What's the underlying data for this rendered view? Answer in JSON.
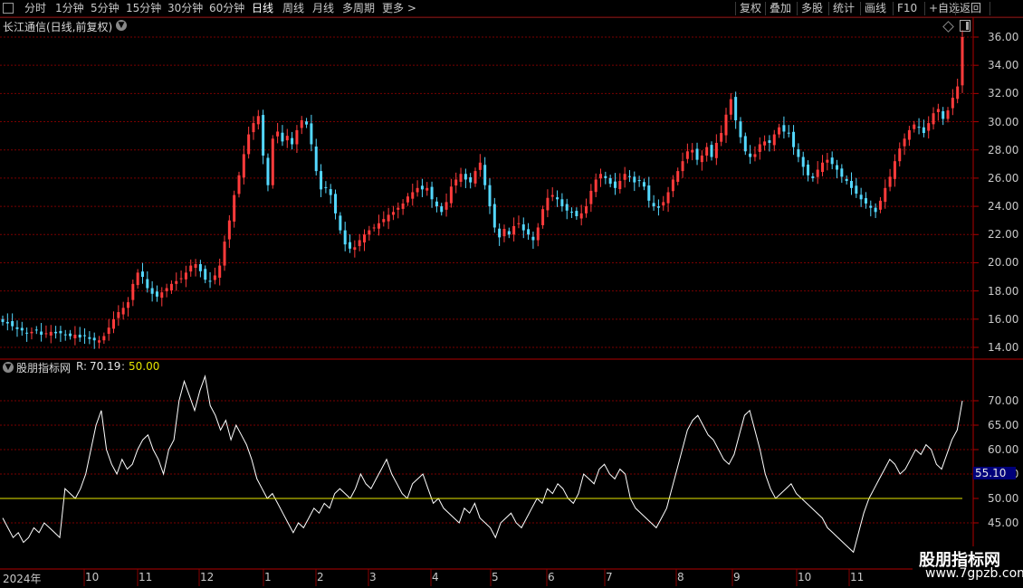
{
  "toolbar": {
    "periods": [
      "分时",
      "1分钟",
      "5分钟",
      "15分钟",
      "30分钟",
      "60分钟",
      "日线",
      "周线",
      "月线",
      "多周期",
      "更多 >"
    ],
    "active_period": "日线",
    "right_buttons": [
      "复权",
      "叠加",
      "多股",
      "统计",
      "画线",
      "F10",
      "+自选",
      "返回"
    ]
  },
  "main_chart": {
    "title": "长江通信(日线,前复权)",
    "y_ticks": [
      "36.00",
      "34.00",
      "32.00",
      "30.00",
      "28.00",
      "26.00",
      "24.00",
      "22.00",
      "20.00",
      "18.00",
      "16.00",
      "14.00"
    ],
    "up_color": "#ff3b3b",
    "down_color": "#54d8ff"
  },
  "indicator": {
    "name": "股朋指标网",
    "r_label": "R:",
    "r_value": "70.19",
    "separator": ":",
    "level_value": "50.00",
    "y_ticks": [
      "70.00",
      "65.00",
      "60.00",
      "55.00",
      "50.00",
      "45.00"
    ],
    "current_value": "55.10",
    "line_color": "#ffffff",
    "level_color": "#e6e600"
  },
  "x_axis": {
    "labels": [
      "2024年",
      "10",
      "11",
      "12",
      "1",
      "2",
      "3",
      "4",
      "5",
      "6",
      "7",
      "8",
      "9",
      "10",
      "11"
    ]
  },
  "watermark": {
    "title": "股朋指标网",
    "url": "www.7gpzb.com"
  },
  "chart_data": [
    {
      "type": "candlestick",
      "title": "长江通信(日线,前复权)",
      "ylim": [
        13.2,
        37.0
      ],
      "x_labels": [
        "2024年",
        "10",
        "11",
        "12",
        "1",
        "2",
        "3",
        "4",
        "5",
        "6",
        "7",
        "8",
        "9",
        "10",
        "11"
      ],
      "close": [
        15.8,
        15.7,
        15.5,
        15.3,
        15.2,
        15.0,
        15.1,
        15.2,
        14.9,
        15.0,
        15.1,
        15.0,
        15.0,
        14.9,
        14.8,
        14.9,
        14.7,
        14.8,
        14.6,
        14.5,
        14.5,
        14.8,
        15.4,
        16.0,
        16.5,
        16.8,
        17.2,
        18.5,
        19.3,
        19.0,
        18.2,
        17.8,
        17.6,
        17.9,
        18.2,
        18.5,
        18.7,
        18.9,
        19.3,
        19.8,
        19.9,
        19.4,
        18.8,
        18.7,
        19.1,
        19.8,
        21.5,
        23.0,
        24.8,
        26.2,
        27.7,
        29.1,
        29.9,
        30.4,
        27.6,
        25.5,
        28.8,
        29.3,
        28.6,
        29.0,
        28.4,
        29.4,
        30.1,
        29.8,
        28.4,
        26.5,
        25.2,
        25.3,
        24.8,
        23.5,
        22.3,
        21.3,
        21.0,
        21.1,
        21.6,
        22.0,
        22.3,
        22.5,
        22.8,
        23.1,
        23.4,
        23.6,
        23.9,
        24.2,
        24.7,
        25.0,
        25.3,
        25.2,
        25.3,
        24.5,
        24.0,
        23.6,
        24.3,
        25.4,
        25.9,
        26.3,
        25.9,
        25.7,
        26.5,
        27.1,
        25.5,
        24.0,
        22.5,
        21.8,
        22.4,
        22.0,
        22.6,
        22.8,
        22.3,
        22.0,
        21.6,
        22.5,
        23.8,
        24.6,
        24.8,
        24.5,
        24.0,
        23.7,
        23.6,
        23.3,
        23.5,
        24.0,
        25.1,
        25.9,
        26.3,
        26.0,
        25.6,
        25.3,
        25.8,
        26.3,
        26.1,
        25.7,
        25.8,
        25.4,
        24.4,
        24.0,
        23.9,
        24.3,
        25.0,
        25.9,
        26.5,
        27.2,
        27.9,
        28.0,
        27.3,
        27.6,
        28.2,
        27.5,
        28.5,
        29.2,
        30.5,
        31.6,
        30.1,
        28.9,
        27.9,
        27.5,
        27.7,
        28.4,
        28.6,
        28.5,
        29.1,
        29.6,
        29.3,
        29.2,
        28.2,
        27.5,
        26.8,
        26.2,
        26.0,
        26.6,
        27.1,
        27.3,
        27.0,
        26.6,
        26.1,
        25.8,
        25.3,
        24.9,
        24.5,
        24.2,
        23.9,
        23.6,
        24.4,
        25.3,
        26.1,
        27.2,
        28.1,
        28.8,
        29.4,
        29.8,
        29.6,
        29.2,
        29.9,
        30.6,
        30.9,
        30.2,
        30.8,
        31.7,
        32.5,
        36.0
      ],
      "ytick_labels": [
        "36.00",
        "34.00",
        "32.00",
        "30.00",
        "28.00",
        "26.00",
        "24.00",
        "22.00",
        "20.00",
        "18.00",
        "16.00",
        "14.00"
      ]
    },
    {
      "type": "line",
      "title": "股朋指标网",
      "ylim": [
        38,
        78
      ],
      "series": [
        {
          "name": "R",
          "values": [
            46,
            44,
            42,
            43,
            41,
            42,
            44,
            43,
            45,
            44,
            43,
            42,
            52,
            51,
            50,
            52,
            55,
            60,
            65,
            68,
            60,
            57,
            55,
            58,
            56,
            57,
            60,
            62,
            63,
            60,
            58,
            55,
            60,
            62,
            70,
            74,
            71,
            68,
            72,
            75,
            69,
            67,
            64,
            66,
            62,
            65,
            63,
            61,
            58,
            54,
            52,
            50,
            51,
            49,
            47,
            45,
            43,
            45,
            44,
            46,
            48,
            47,
            49,
            48,
            51,
            52,
            51,
            50,
            52,
            55,
            53,
            52,
            54,
            56,
            58,
            55,
            53,
            51,
            50,
            53,
            54,
            55,
            52,
            49,
            50,
            48,
            47,
            46,
            45,
            48,
            47,
            49,
            46,
            45,
            44,
            42,
            45,
            46,
            47,
            45,
            44,
            46,
            48,
            50,
            49,
            52,
            51,
            53,
            52,
            50,
            49,
            51,
            55,
            54,
            53,
            56,
            57,
            55,
            54,
            56,
            55,
            50,
            48,
            47,
            46,
            45,
            44,
            46,
            48,
            52,
            56,
            60,
            64,
            66,
            67,
            65,
            63,
            62,
            60,
            58,
            57,
            59,
            63,
            67,
            68,
            64,
            60,
            55,
            52,
            50,
            51,
            52,
            53,
            51,
            50,
            49,
            48,
            47,
            46,
            44,
            43,
            42,
            41,
            40,
            39,
            43,
            47,
            50,
            52,
            54,
            56,
            58,
            57,
            55,
            56,
            58,
            60,
            59,
            61,
            60,
            57,
            56,
            59,
            62,
            64,
            70
          ]
        }
      ],
      "reference_line": 50.0,
      "current_value": 55.1,
      "ytick_labels": [
        "70.00",
        "65.00",
        "60.00",
        "55.00",
        "50.00",
        "45.00"
      ]
    }
  ]
}
